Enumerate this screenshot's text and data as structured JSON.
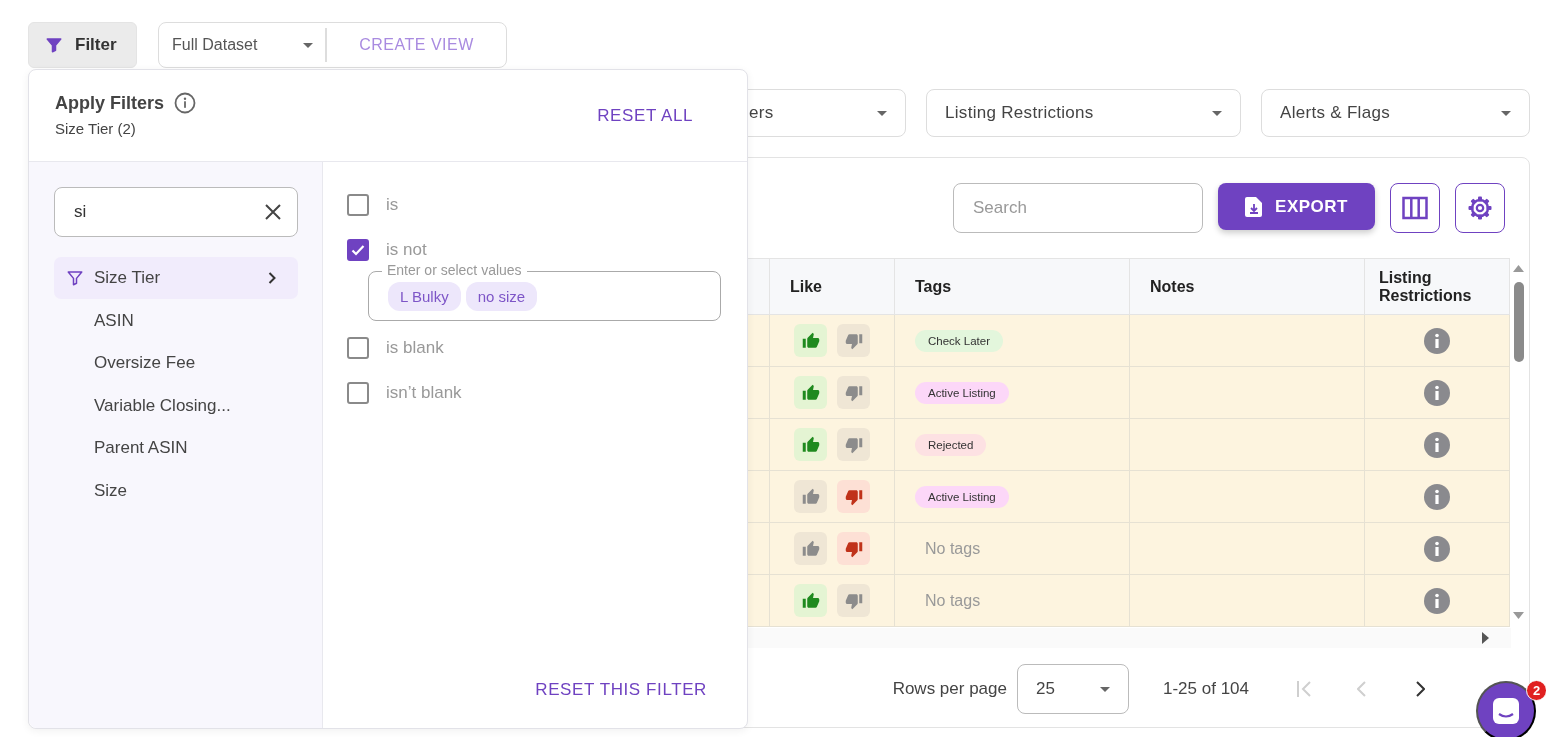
{
  "toolbar": {
    "filter_button": "Filter",
    "view_select": "Full Dataset",
    "create_view": "CREATE VIEW"
  },
  "filter_dropdowns": [
    {
      "label": "ers"
    },
    {
      "label": "Listing Restrictions"
    },
    {
      "label": "Alerts & Flags"
    }
  ],
  "table_toolbar": {
    "search_placeholder": "Search",
    "export_button": "EXPORT"
  },
  "table": {
    "columns": [
      "Like",
      "Tags",
      "Notes",
      "Listing Restrictions"
    ],
    "rows": [
      {
        "liked": true,
        "disliked": false,
        "tag": {
          "label": "Check Later",
          "color": "#e3f6dc"
        }
      },
      {
        "liked": true,
        "disliked": false,
        "tag": {
          "label": "Active Listing",
          "color": "#fcd7f8"
        }
      },
      {
        "liked": true,
        "disliked": false,
        "tag": {
          "label": "Rejected",
          "color": "#fde1e3"
        }
      },
      {
        "liked": false,
        "disliked": true,
        "tag": {
          "label": "Active Listing",
          "color": "#fcd7f8"
        }
      },
      {
        "liked": false,
        "disliked": true,
        "no_tags": "No tags"
      },
      {
        "liked": true,
        "disliked": false,
        "no_tags": "No tags"
      }
    ]
  },
  "pagination": {
    "rows_per_page_label": "Rows per page",
    "rows_per_page": "25",
    "range": "1-25 of 104",
    "nav": [
      {
        "kind": "first",
        "disabled": true
      },
      {
        "kind": "previous",
        "disabled": true
      },
      {
        "kind": "next",
        "disabled": false
      }
    ]
  },
  "chat": {
    "badge": "2"
  },
  "filter_panel": {
    "title": "Apply Filters",
    "subtitle": "Size Tier (2)",
    "reset_all": "RESET ALL",
    "search_value": "si",
    "fields": [
      {
        "label": "Size Tier",
        "selected": true
      },
      {
        "label": "ASIN",
        "selected": false
      },
      {
        "label": "Oversize Fee",
        "selected": false
      },
      {
        "label": "Variable Closing...",
        "selected": false
      },
      {
        "label": "Parent ASIN",
        "selected": false
      },
      {
        "label": "Size",
        "selected": false
      }
    ],
    "conditions": [
      {
        "label": "is",
        "checked": false
      },
      {
        "label": "is not",
        "checked": true,
        "values": {
          "legend": "Enter or select values",
          "chips": [
            "L Bulky",
            "no size"
          ]
        }
      },
      {
        "label": "is blank",
        "checked": false
      },
      {
        "label": "isn’t blank",
        "checked": false
      }
    ],
    "reset_filter": "RESET THIS FILTER"
  }
}
